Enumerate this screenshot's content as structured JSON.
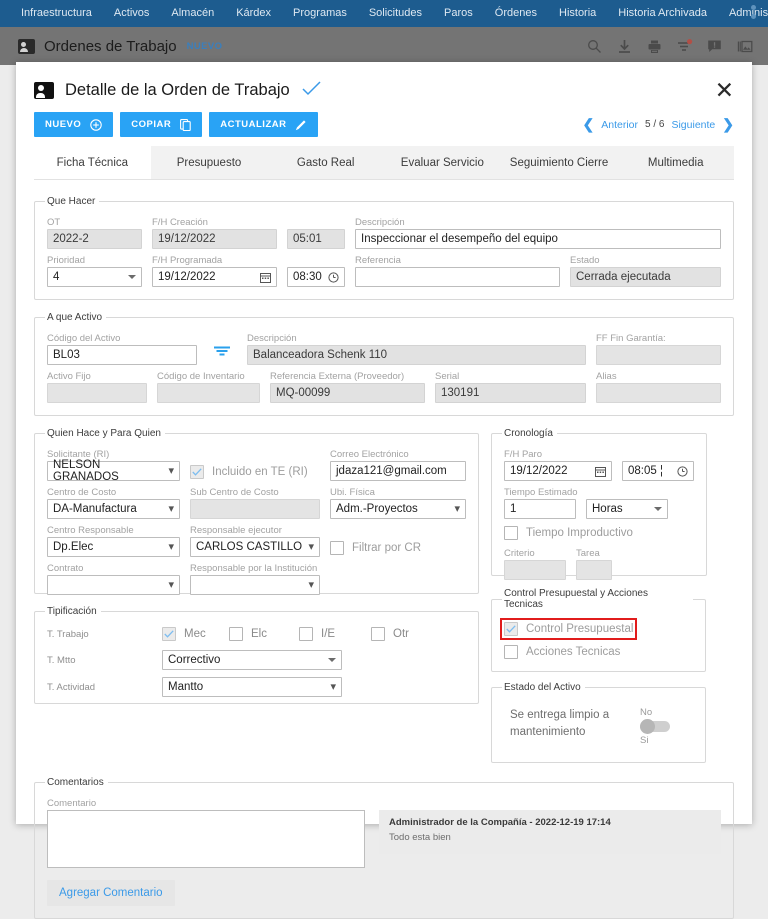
{
  "topnav": {
    "items": [
      {
        "label": "Infraestructura"
      },
      {
        "label": "Activos"
      },
      {
        "label": "Almacén"
      },
      {
        "label": "Kárdex"
      },
      {
        "label": "Programas"
      },
      {
        "label": "Solicitudes"
      },
      {
        "label": "Paros"
      },
      {
        "label": "Órdenes"
      },
      {
        "label": "Historia"
      },
      {
        "label": "Historia Archivada"
      },
      {
        "label": "Administración"
      }
    ]
  },
  "appheader": {
    "title": "Ordenes de Trabajo",
    "new_label": "NUEVO",
    "icons": [
      "search-icon",
      "download-icon",
      "print-icon",
      "filter-icon",
      "notes-icon",
      "gallery-icon"
    ]
  },
  "modal": {
    "title": "Detalle de la Orden de Trabajo",
    "close_label": "✕",
    "actions": [
      {
        "label": "NUEVO",
        "icon": "plus-circle-icon"
      },
      {
        "label": "COPIAR",
        "icon": "copy-icon"
      },
      {
        "label": "ACTUALIZAR",
        "icon": "pencil-icon"
      }
    ],
    "pager": {
      "prev": "Anterior",
      "count": "5 / 6",
      "next": "Siguiente"
    },
    "tabs": [
      {
        "label": "Ficha Técnica",
        "active": true
      },
      {
        "label": "Presupuesto",
        "active": false
      },
      {
        "label": "Gasto Real",
        "active": false
      },
      {
        "label": "Evaluar Servicio",
        "active": false
      },
      {
        "label": "Seguimiento Cierre",
        "active": false
      },
      {
        "label": "Multimedia",
        "active": false
      }
    ]
  },
  "que_hacer": {
    "legend": "Que Hacer",
    "ot_label": "OT",
    "ot_value": "2022-2",
    "fh_creacion_label": "F/H Creación",
    "fh_creacion_value": "19/12/2022",
    "fh_creacion_time": "05:01",
    "descripcion_label": "Descripción",
    "descripcion_value": "Inspeccionar el desempeño del equipo",
    "prioridad_label": "Prioridad",
    "prioridad_value": "4",
    "fh_programada_label": "F/H Programada",
    "fh_programada_value": "19/12/2022",
    "fh_programada_time": "08:30",
    "referencia_label": "Referencia",
    "referencia_value": "",
    "estado_label": "Estado",
    "estado_value": "Cerrada ejecutada"
  },
  "a_que_activo": {
    "legend": "A que Activo",
    "codigo_label": "Código del Activo",
    "codigo_value": "BL03",
    "descripcion_label": "Descripción",
    "descripcion_value": "Balanceadora Schenk 110",
    "ff_fin_garantia_label": "FF Fin Garantía:",
    "ff_fin_garantia_value": "",
    "activo_fijo_label": "Activo Fijo",
    "activo_fijo_value": "",
    "codigo_inventario_label": "Código de Inventario",
    "codigo_inventario_value": "",
    "referencia_externa_label": "Referencia Externa (Proveedor)",
    "referencia_externa_value": "MQ-00099",
    "serial_label": "Serial",
    "serial_value": "130191",
    "alias_label": "Alias",
    "alias_value": ""
  },
  "quien_hace": {
    "legend": "Quien Hace y Para Quien",
    "solicitante_label": "Solicitante (RI)",
    "solicitante_value": "NELSON GRANADOS",
    "incluido_te_label": "Incluido en TE (RI)",
    "incluido_te_checked": true,
    "correo_label": "Correo Electrónico",
    "correo_value": "jdaza121@gmail.com",
    "centro_costo_label": "Centro de Costo",
    "centro_costo_value": "DA-Manufactura",
    "sub_centro_label": "Sub Centro de Costo",
    "sub_centro_value": "",
    "ubi_fisica_label": "Ubi. Física",
    "ubi_fisica_value": "Adm.-Proyectos",
    "centro_responsable_label": "Centro Responsable",
    "centro_responsable_value": "Dp.Elec",
    "responsable_ejecutor_label": "Responsable ejecutor",
    "responsable_ejecutor_value": "CARLOS CASTILLO",
    "filtrar_cr_label": "Filtrar por CR",
    "filtrar_cr_checked": false,
    "contrato_label": "Contrato",
    "contrato_value": "",
    "responsable_institucion_label": "Responsable por la Institución",
    "responsable_institucion_value": ""
  },
  "cronologia": {
    "legend": "Cronología",
    "fh_paro_label": "F/H Paro",
    "fh_paro_value": "19/12/2022",
    "fh_paro_time": "08:05 ¦",
    "tiempo_estimado_label": "Tiempo Estimado",
    "tiempo_estimado_value": "1",
    "tiempo_unidad_value": "Horas",
    "tiempo_improductivo_label": "Tiempo Improductivo",
    "tiempo_improductivo_checked": false,
    "criterio_label": "Criterio",
    "criterio_value": "",
    "tarea_label": "Tarea",
    "tarea_value": ""
  },
  "tipificacion": {
    "legend": "Tipificación",
    "t_trabajo_label": "T. Trabajo",
    "checks": [
      {
        "label": "Mec",
        "checked": true
      },
      {
        "label": "Elc",
        "checked": false
      },
      {
        "label": "I/E",
        "checked": false
      },
      {
        "label": "Otr",
        "checked": false
      }
    ],
    "t_mtto_label": "T. Mtto",
    "t_mtto_value": "Correctivo",
    "t_actividad_label": "T. Actividad",
    "t_actividad_value": "Mantto"
  },
  "control_presupuestal": {
    "legend": "Control Presupuestal y Acciones Tecnicas",
    "control_label": "Control Presupuestal",
    "control_checked": true,
    "control_highlighted": true,
    "acciones_label": "Acciones Tecnicas",
    "acciones_checked": false
  },
  "estado_activo": {
    "legend": "Estado del Activo",
    "text": "Se entrega limpio a mantenimiento",
    "toggle_no": "No",
    "toggle_si": "Si",
    "toggle_on": false
  },
  "comentarios": {
    "legend": "Comentarios",
    "comentario_label": "Comentario",
    "comentario_value": "",
    "add_button": "Agregar Comentario",
    "items": [
      {
        "meta": "Administrador de la Compañía - 2022-12-19 17:14",
        "text": "Todo esta bien"
      }
    ]
  },
  "colors": {
    "nav_blue": "#1d5c8f",
    "accent_blue": "#29a3f5",
    "link_blue": "#3b9ae8",
    "highlight_red": "#e11c1c",
    "header_gray": "#747474"
  }
}
